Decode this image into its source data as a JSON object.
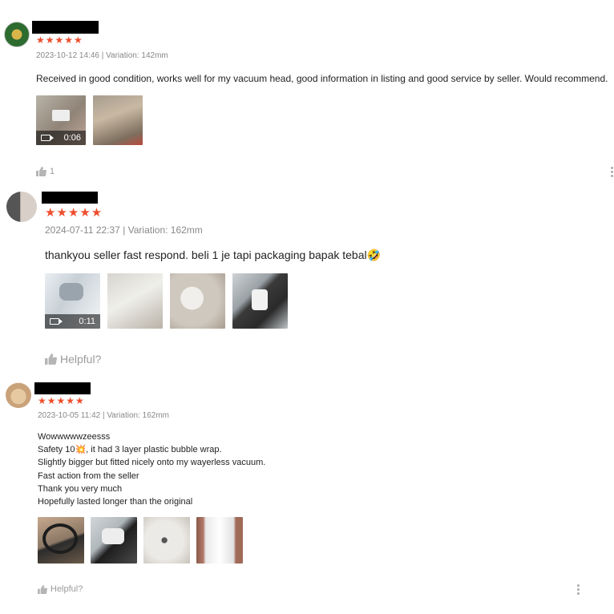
{
  "reviews": [
    {
      "rating": "★★★★★",
      "meta": "2023-10-12 14:46 | Variation: 142mm",
      "text": "Received in good condition, works well for my vacuum head, good information in listing and good service by seller. Would recommend.",
      "video_duration": "0:06",
      "like_count": "1"
    },
    {
      "rating": "★★★★★",
      "meta": "2024-07-11 22:37 | Variation: 162mm",
      "text": "thankyou seller fast respond. beli 1 je tapi packaging bapak tebal🤣",
      "video_duration": "0:11",
      "helpful_label": "Helpful?"
    },
    {
      "rating": "★★★★★",
      "meta": "2023-10-05 11:42 | Variation: 162mm",
      "text": "Wowwwwwzeesss\nSafety 10💥, it had 3 layer plastic bubble wrap.\nSlightly bigger but fitted nicely onto my wayerless vacuum.\nFast action from the seller\nThank you very much\nHopefully lasted longer than the original",
      "helpful_label": "Helpful?"
    }
  ],
  "colors": {
    "star": "#ee4d2d",
    "meta": "#888888",
    "like": "#9a9a9a"
  },
  "icons": [
    "thumbs-up-icon",
    "more-options-icon",
    "video-camera-icon"
  ]
}
